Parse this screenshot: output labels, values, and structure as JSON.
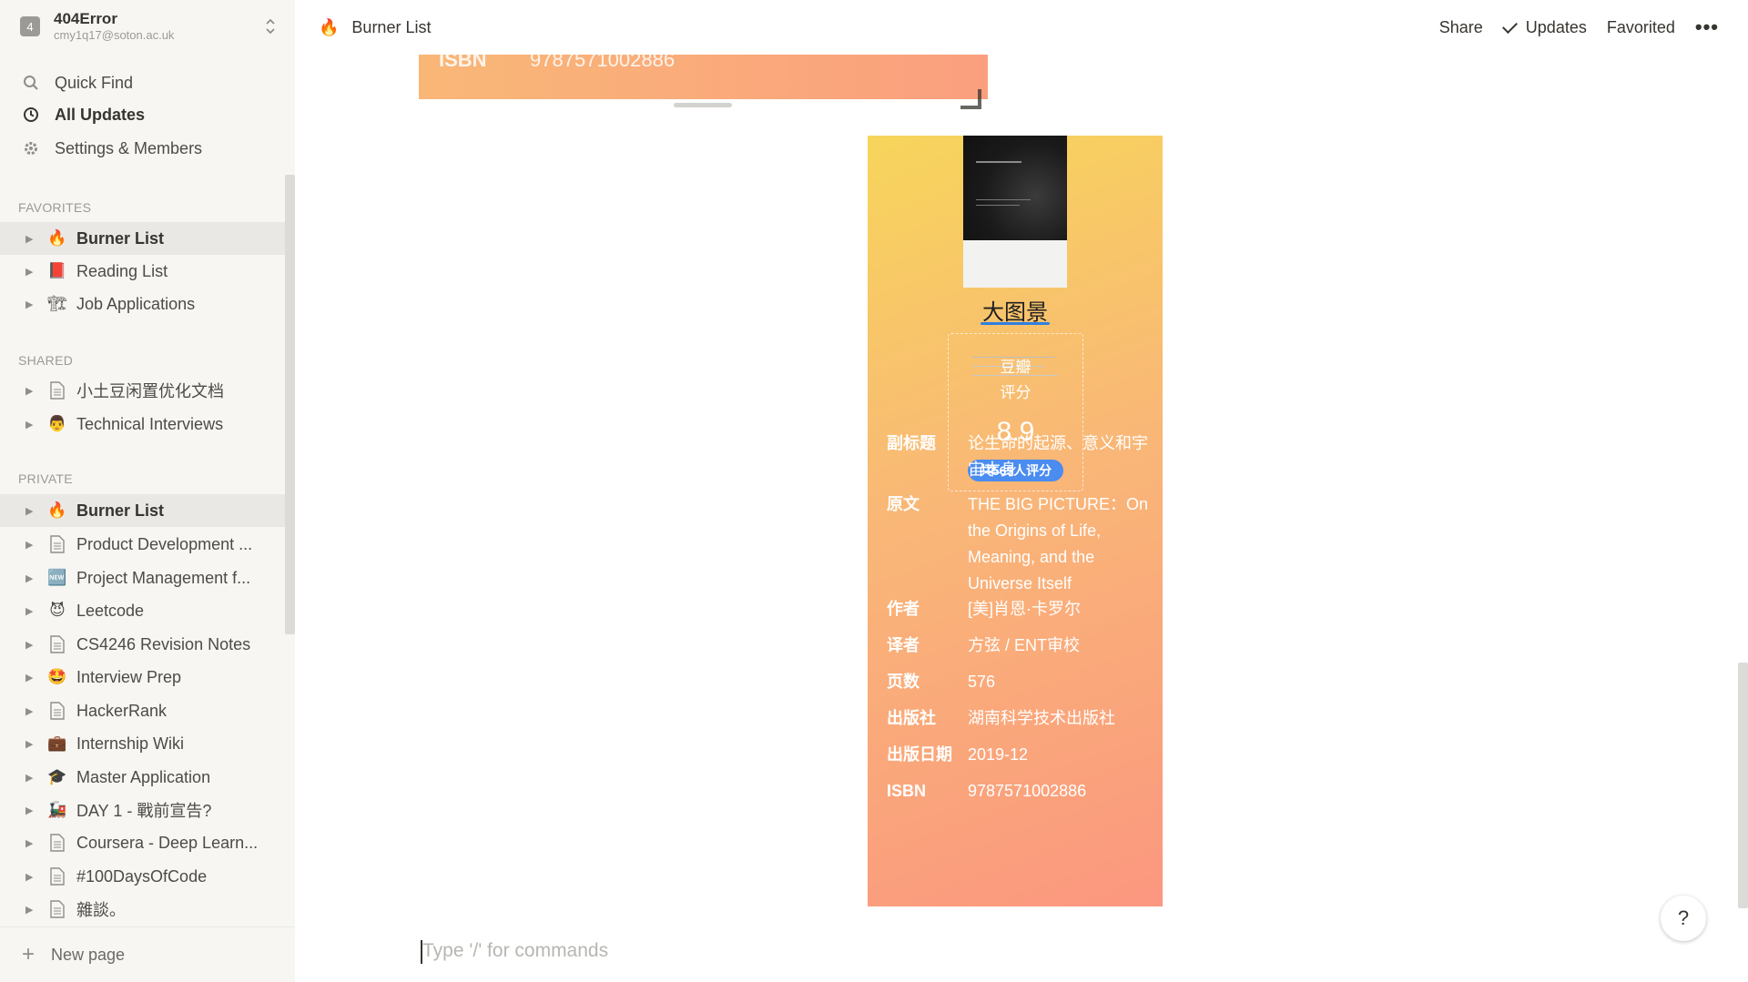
{
  "workspace": {
    "icon_letter": "4",
    "name": "404Error",
    "email": "cmy1q17@soton.ac.uk"
  },
  "sidebar": {
    "nav": [
      {
        "label": "Quick Find",
        "icon": "search-icon"
      },
      {
        "label": "All Updates",
        "icon": "clock-icon"
      },
      {
        "label": "Settings & Members",
        "icon": "gear-icon"
      }
    ],
    "sections": {
      "favorites": "FAVORITES",
      "shared": "SHARED",
      "private": "PRIVATE"
    },
    "favorites": [
      {
        "label": "Burner List",
        "icon": "🔥"
      },
      {
        "label": "Reading List",
        "icon": "📕"
      },
      {
        "label": "Job Applications",
        "icon": "🏗"
      }
    ],
    "shared": [
      {
        "label": "小土豆闲置优化文档",
        "icon": "page-icon"
      },
      {
        "label": "Technical Interviews",
        "icon": "👨"
      }
    ],
    "private": [
      {
        "label": "Burner List",
        "icon": "🔥"
      },
      {
        "label": "Product Development ...",
        "icon": "page-icon"
      },
      {
        "label": "Project Management f...",
        "icon": "🆕"
      },
      {
        "label": "Leetcode",
        "icon": "😈"
      },
      {
        "label": "CS4246 Revision Notes",
        "icon": "page-icon"
      },
      {
        "label": "Interview Prep",
        "icon": "🤩"
      },
      {
        "label": "HackerRank",
        "icon": "page-icon"
      },
      {
        "label": "Internship Wiki",
        "icon": "💼"
      },
      {
        "label": "Master Application",
        "icon": "🎓"
      },
      {
        "label": "DAY 1 - 戰前宣告?",
        "icon": "🚂"
      },
      {
        "label": "Coursera - Deep Learn...",
        "icon": "page-icon"
      },
      {
        "label": "#100DaysOfCode",
        "icon": "page-icon"
      },
      {
        "label": "雜談。",
        "icon": "page-icon"
      }
    ],
    "new_page": "New page"
  },
  "topbar": {
    "breadcrumb_icon": "🔥",
    "breadcrumb": "Burner List",
    "share": "Share",
    "updates": "Updates",
    "favorited": "Favorited",
    "more": "•••"
  },
  "previous_card": {
    "isbn_label": "ISBN",
    "isbn_value": "9787571002886"
  },
  "book": {
    "title": "大图景",
    "rating_source_line1": "豆瓣",
    "rating_source_line2": "评分",
    "rating": "8.9",
    "rating_count": "共565人评分",
    "fields": [
      {
        "key": "副标题",
        "value": "论生命的起源、意义和宇宙本身"
      },
      {
        "key": "原文",
        "value": "THE BIG PICTURE：On the Origins of Life, Meaning, and the Universe Itself"
      },
      {
        "key": "作者",
        "value": "[美]肖恩·卡罗尔"
      },
      {
        "key": "译者",
        "value": "方弦 / ENT审校"
      },
      {
        "key": "页数",
        "value": "576"
      },
      {
        "key": "出版社",
        "value": "湖南科学技术出版社"
      },
      {
        "key": "出版日期",
        "value": "2019-12"
      },
      {
        "key": "ISBN",
        "value": "9787571002886"
      }
    ]
  },
  "editor": {
    "placeholder": "Type '/' for commands"
  },
  "help_button": "?"
}
